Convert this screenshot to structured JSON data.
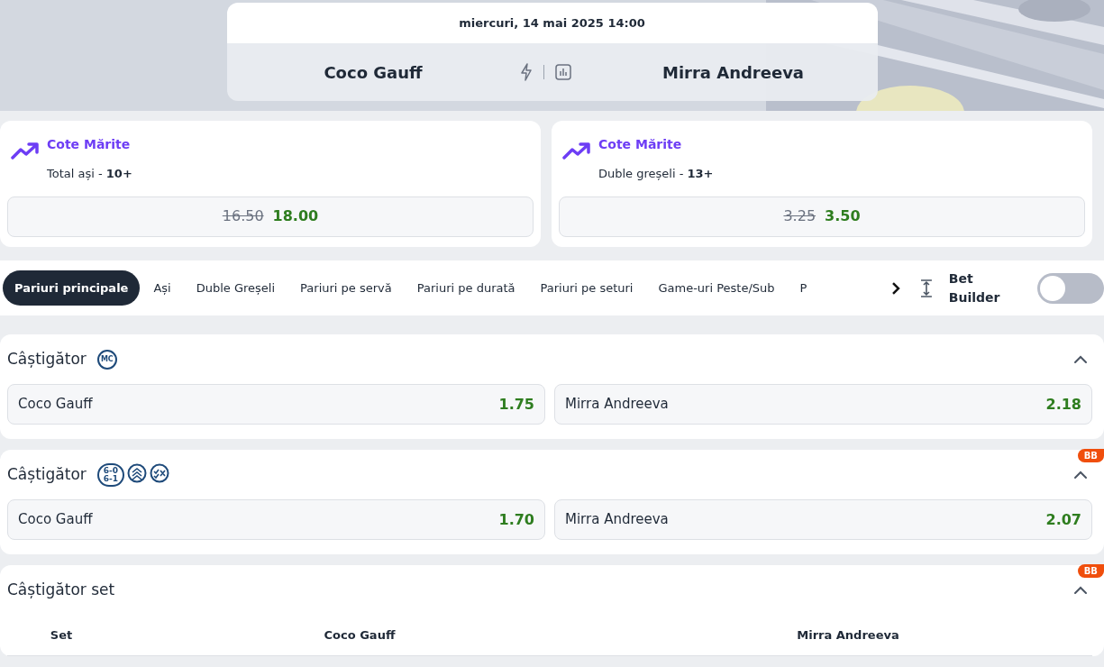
{
  "match": {
    "date": "miercuri, 14 mai 2025 14:00",
    "home": "Coco Gauff",
    "away": "Mirra Andreeva"
  },
  "boosts": [
    {
      "title": "Cote Mărite",
      "market": "Total ași - ",
      "line": "10+",
      "old_odds": "16.50",
      "new_odds": "18.00"
    },
    {
      "title": "Cote Mărite",
      "market": "Duble greșeli - ",
      "line": "13+",
      "old_odds": "3.25",
      "new_odds": "3.50"
    }
  ],
  "tabs": [
    {
      "label": "Pariuri principale",
      "selected": true
    },
    {
      "label": "Ași",
      "selected": false
    },
    {
      "label": "Duble Greșeli",
      "selected": false
    },
    {
      "label": "Pariuri pe servă",
      "selected": false
    },
    {
      "label": "Pariuri pe durată",
      "selected": false
    },
    {
      "label": "Pariuri pe seturi",
      "selected": false
    },
    {
      "label": "Game-uri Peste/Sub",
      "selected": false
    },
    {
      "label": "P",
      "selected": false
    }
  ],
  "bet_builder": {
    "label": "Bet Builder",
    "on": false
  },
  "markets": [
    {
      "title": "Câștigător",
      "expanded": true,
      "icons": [
        {
          "kind": "text",
          "label": "MC"
        }
      ],
      "selections": [
        {
          "name": "Coco Gauff",
          "odds": "1.75"
        },
        {
          "name": "Mirra Andreeva",
          "odds": "2.18"
        }
      ]
    },
    {
      "title": "Câștigător",
      "bb_badge": "BB",
      "expanded": true,
      "icons": [
        {
          "kind": "score",
          "label": "6-0 6-1"
        },
        {
          "kind": "chevrons"
        },
        {
          "kind": "checkx"
        }
      ],
      "selections": [
        {
          "name": "Coco Gauff",
          "odds": "1.70"
        },
        {
          "name": "Mirra Andreeva",
          "odds": "2.07"
        }
      ]
    },
    {
      "title": "Câștigător set",
      "bb_badge": "BB",
      "expanded": true,
      "columns": [
        "Set",
        "Coco Gauff",
        "Mirra Andreeva"
      ]
    }
  ]
}
